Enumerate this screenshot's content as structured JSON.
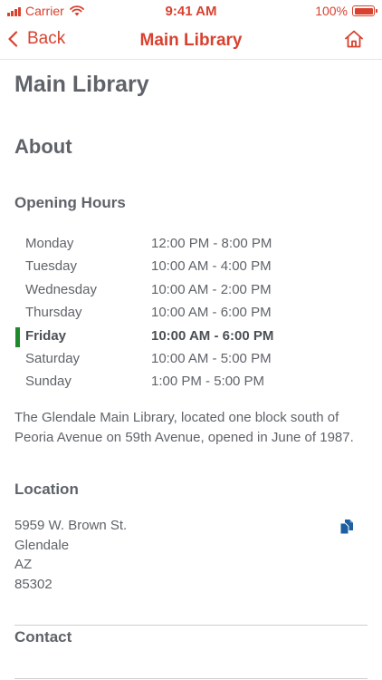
{
  "status_bar": {
    "carrier": "Carrier",
    "time": "9:41 AM",
    "battery_percent": "100%",
    "battery_level": 1.0,
    "accent_color": "#d8412f"
  },
  "nav": {
    "back_label": "Back",
    "title": "Main Library",
    "back_icon": "chevron-left-icon",
    "home_icon": "home-icon"
  },
  "page": {
    "title": "Main Library",
    "about_heading": "About",
    "hours_heading": "Opening Hours",
    "hours": [
      {
        "day": "Monday",
        "time": "12:00 PM - 8:00 PM",
        "today": false
      },
      {
        "day": "Tuesday",
        "time": "10:00 AM - 4:00 PM",
        "today": false
      },
      {
        "day": "Wednesday",
        "time": "10:00 AM - 2:00 PM",
        "today": false
      },
      {
        "day": "Thursday",
        "time": "10:00 AM - 6:00 PM",
        "today": false
      },
      {
        "day": "Friday",
        "time": "10:00 AM - 6:00 PM",
        "today": true
      },
      {
        "day": "Saturday",
        "time": "10:00 AM - 5:00 PM",
        "today": false
      },
      {
        "day": "Sunday",
        "time": "1:00 PM - 5:00 PM",
        "today": false
      }
    ],
    "today_marker_color": "#1f8a2c",
    "description": "The Glendale Main Library, located one block south of Peoria Avenue on 59th Avenue, opened in June of 1987.",
    "location_heading": "Location",
    "address_lines": [
      "5959 W. Brown St.",
      "Glendale",
      "AZ",
      "85302"
    ],
    "copy_icon": "copy-icon",
    "copy_icon_color": "#1d5fa0",
    "contact_heading": "Contact"
  }
}
